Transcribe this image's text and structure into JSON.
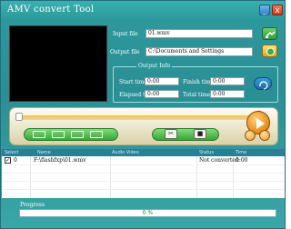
{
  "window": {
    "title": "AMV convert Tool"
  },
  "titlebar": {
    "minimize_glyph": "_",
    "close_glyph": "x"
  },
  "files": {
    "input_label": "Input file",
    "input_value": "01.wmv",
    "output_label": "Output file",
    "output_value": "C:\\Documents and Settings"
  },
  "output_info": {
    "title": "Output Info",
    "start_label": "Start time",
    "start_value": "0:00",
    "finish_label": "Finish time",
    "finish_value": "0:00",
    "elapsed_label": "Elapsed time",
    "elapsed_value": "0:00",
    "total_label": "Total time",
    "total_value": "0:00"
  },
  "player": {
    "seek_position": 0
  },
  "list": {
    "columns": [
      "Select",
      "Name",
      "Audio Video",
      "Status",
      "Time"
    ],
    "rows": [
      {
        "selected": true,
        "name": "F:\\flashfxp\\01.wmv",
        "audio_video": "",
        "status": "Not converted",
        "time": "0:00"
      }
    ]
  },
  "progress": {
    "label": "Progress",
    "text": "0 %",
    "value": 0
  },
  "colors": {
    "accent": "#2e9a9f",
    "progress_text": "#1a7a1a",
    "button_green": "#3aa53a",
    "play_orange": "#e48a1a"
  },
  "icons": [
    "minimize-icon",
    "close-icon",
    "browse-icon",
    "folder-icon",
    "refresh-icon",
    "play-icon"
  ]
}
